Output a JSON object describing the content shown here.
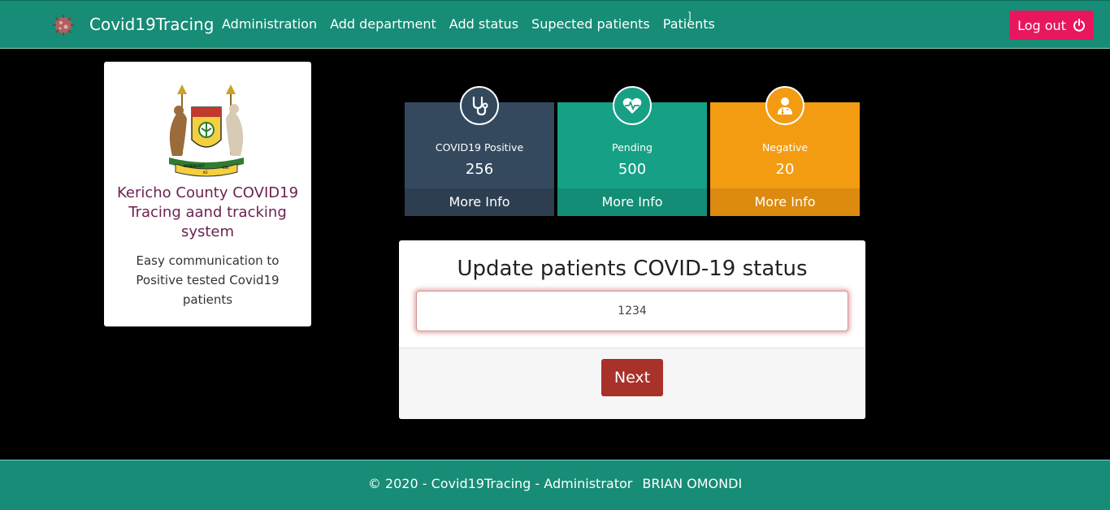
{
  "navbar": {
    "brand": "Covid19Tracing",
    "logo_icon": "virus-icon",
    "links": [
      "Administration",
      "Add department",
      "Add status",
      "Supected patients",
      "Patients"
    ],
    "mark": "]",
    "logout_label": "Log out",
    "logout_icon": "power-icon",
    "logout_color": "#e8175d",
    "bg_color": "#178c76"
  },
  "side_card": {
    "crest_icon": "county-coat-of-arms",
    "crest_text": [
      "NOBEBEIYOT",
      "KO",
      "IBIK"
    ],
    "title": "Kericho County COVID19 Tracing aand tracking system",
    "description": "Easy communication to Positive tested Covid19 patients"
  },
  "stats": [
    {
      "label": "COVID19 Positive",
      "value": "256",
      "more": "More Info",
      "icon": "stethoscope-icon",
      "color": "#34495e"
    },
    {
      "label": "Pending",
      "value": "500",
      "more": "More Info",
      "icon": "heartbeat-icon",
      "color": "#16a085"
    },
    {
      "label": "Negative",
      "value": "20",
      "more": "More Info",
      "icon": "doctor-icon",
      "color": "#f39c12"
    }
  ],
  "update": {
    "title": "Update patients COVID-19 status",
    "input_value": "1234",
    "next_label": "Next",
    "next_color": "#a8312a"
  },
  "footer": {
    "copyright": "© 2020 - Covid19Tracing - Administrator",
    "user": "BRIAN OMONDI"
  }
}
